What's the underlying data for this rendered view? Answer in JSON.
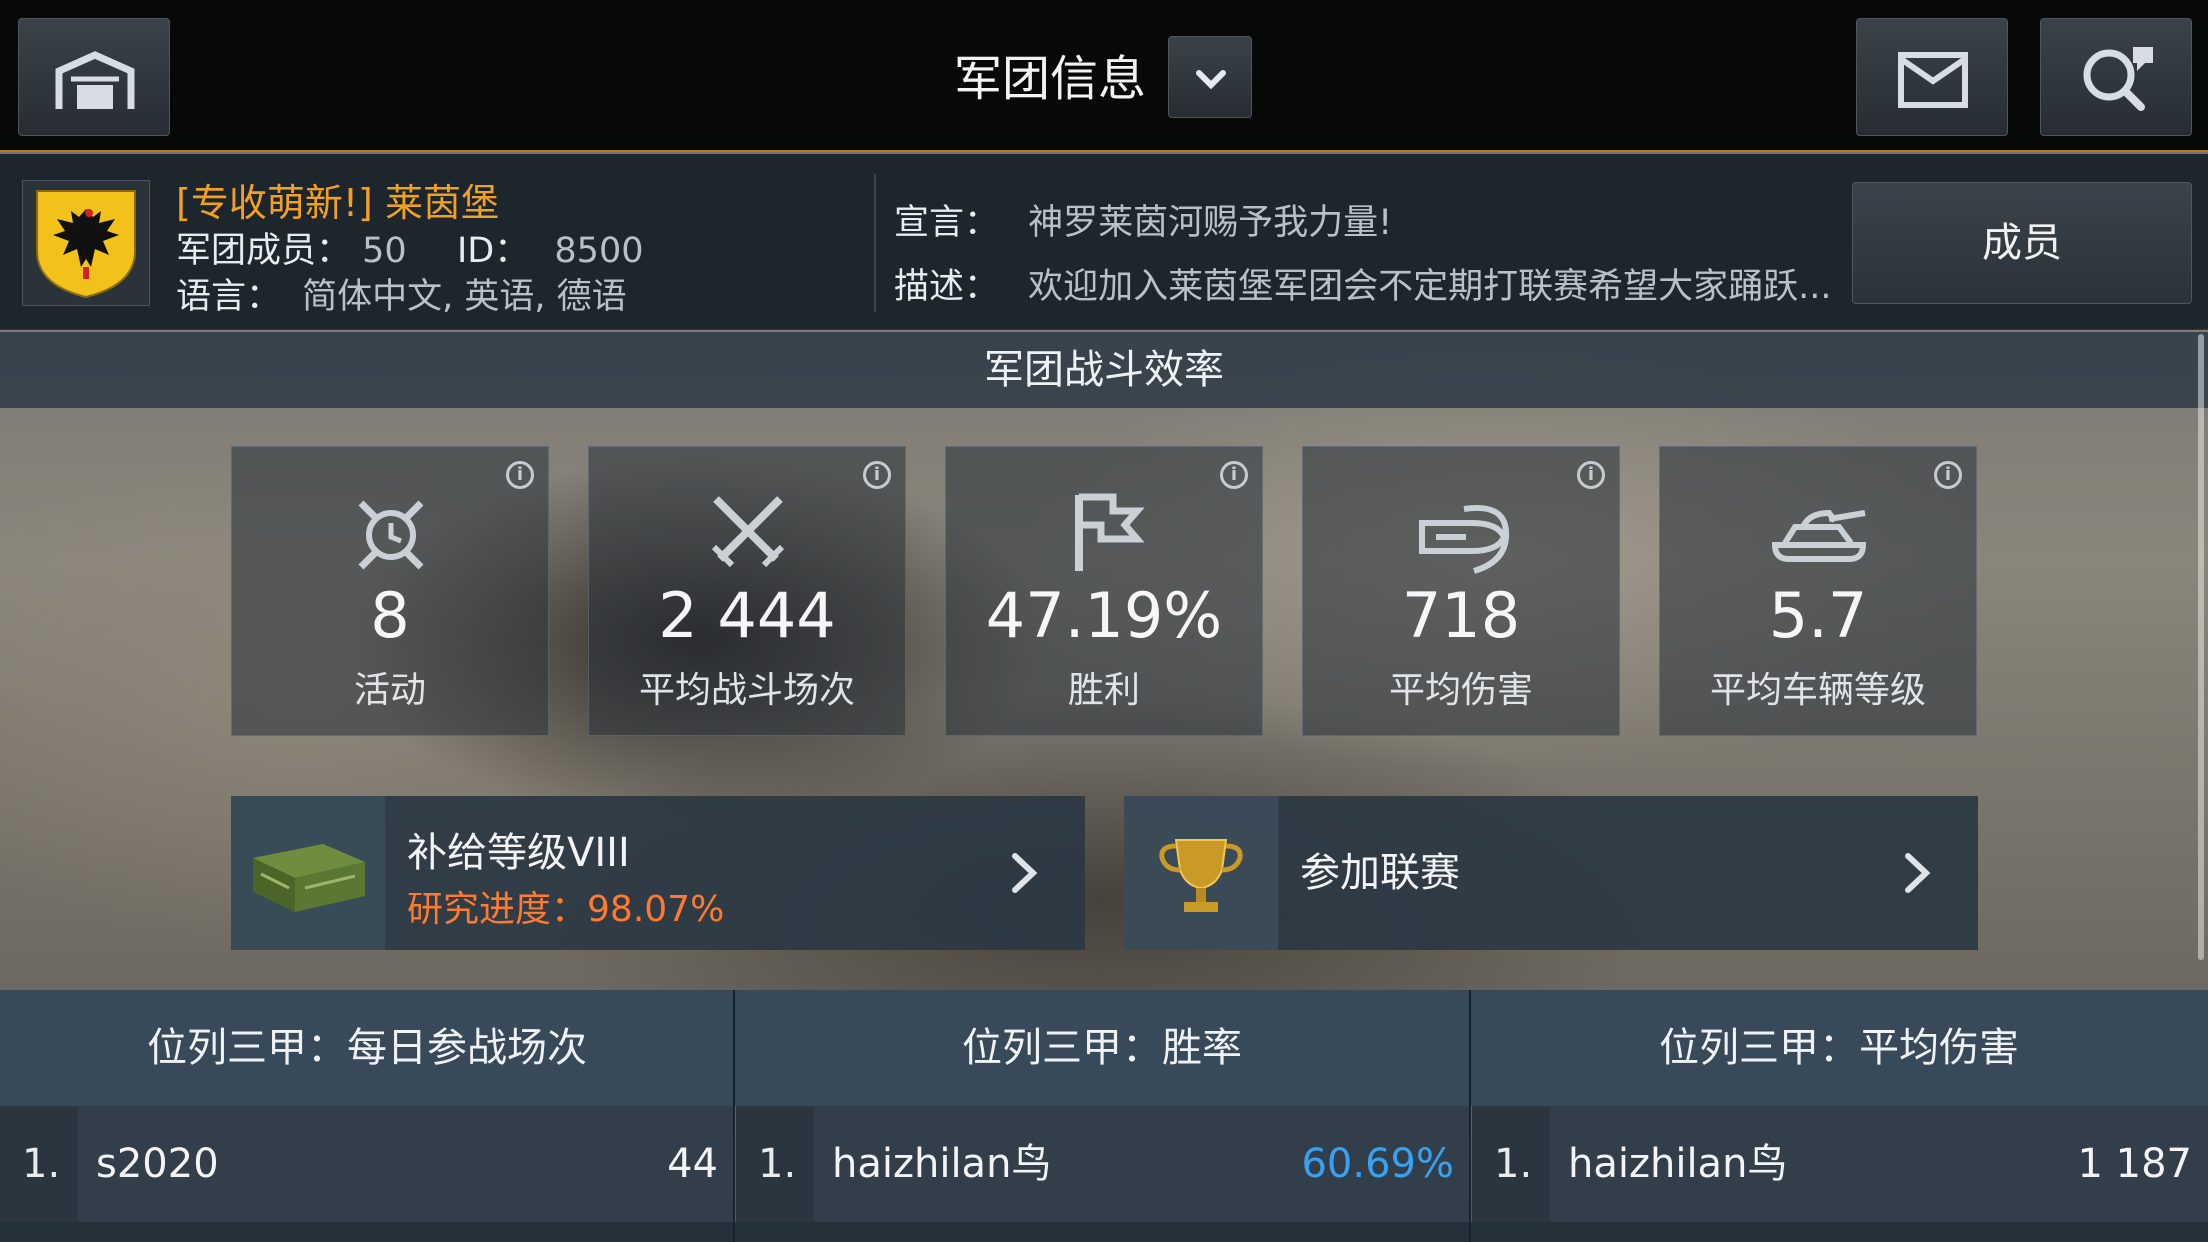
{
  "header": {
    "title": "军团信息",
    "icons": [
      "garage-icon",
      "chevron-down-icon",
      "mail-icon",
      "search-clan-icon"
    ]
  },
  "clan": {
    "name": "[专收萌新!] 莱茵堡",
    "members_label": "军团成员：",
    "members_value": "50",
    "id_label": "ID：",
    "id_value": "8500",
    "language_label": "语言：",
    "language_value": "简体中文, 英语, 德语",
    "motto_label": "宣言：",
    "motto_value": "神罗莱茵河赐予我力量!",
    "desc_label": "描述：",
    "desc_value": "欢迎加入莱茵堡军团会不定期打联赛希望大家踊跃...",
    "members_button": "成员",
    "emblem": "german-eagle-emblem-icon"
  },
  "efficiency": {
    "title": "军团战斗效率",
    "stats": [
      {
        "value": "8",
        "label": "活动",
        "icon": "activity-icon"
      },
      {
        "value": "2 444",
        "label": "平均战斗场次",
        "icon": "crossed-swords-icon"
      },
      {
        "value": "47.19%",
        "label": "胜利",
        "icon": "flag-icon"
      },
      {
        "value": "718",
        "label": "平均伤害",
        "icon": "shell-icon"
      },
      {
        "value": "5.7",
        "label": "平均车辆等级",
        "icon": "tank-icon"
      }
    ]
  },
  "supply": {
    "title": "补给等级VIII",
    "progress_label": "研究进度：",
    "progress_value": "98.07%",
    "progress_fraction": 0.9807
  },
  "league": {
    "label": "参加联赛"
  },
  "leaderboards": [
    {
      "title": "位列三甲：每日参战场次",
      "rank": "1.",
      "name": "s2020",
      "score": "44"
    },
    {
      "title": "位列三甲：胜率",
      "rank": "1.",
      "name": "haizhilan鸟",
      "score": "60.69%"
    },
    {
      "title": "位列三甲：平均伤害",
      "rank": "1.",
      "name": "haizhilan鸟",
      "score": "1 187"
    }
  ],
  "colors": {
    "accent_orange": "#f0a024",
    "progress_orange": "#ff7a2e",
    "highlight_blue": "#3aa0f0",
    "topbar_border": "#c07a1c"
  }
}
